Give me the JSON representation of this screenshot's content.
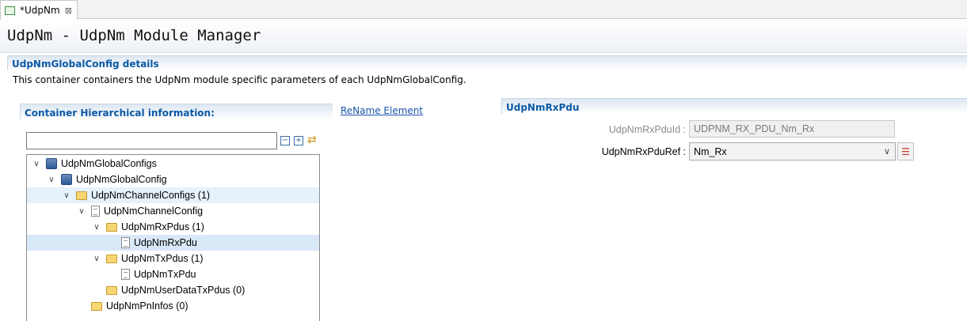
{
  "tab": {
    "label": "*UdpNm",
    "close": "⊠"
  },
  "header": {
    "title": "UdpNm - UdpNm Module Manager"
  },
  "details": {
    "title": "UdpNmGlobalConfig details",
    "description": "This container containers the UdpNm module specific parameters of each UdpNmGlobalConfig."
  },
  "hierarchy": {
    "title": "Container Hierarchical information:",
    "search": {
      "value": "",
      "placeholder": ""
    },
    "tree": [
      {
        "label": "UdpNmGlobalConfigs",
        "level": 0,
        "icon": "database-icon",
        "expanded": true
      },
      {
        "label": "UdpNmGlobalConfig",
        "level": 1,
        "icon": "database-icon",
        "expanded": true
      },
      {
        "label": "UdpNmChannelConfigs (1)",
        "level": 2,
        "icon": "folder-icon",
        "expanded": true,
        "hover": true
      },
      {
        "label": "UdpNmChannelConfig",
        "level": 3,
        "icon": "document-icon",
        "expanded": true
      },
      {
        "label": "UdpNmRxPdus (1)",
        "level": 4,
        "icon": "folder-icon",
        "expanded": true
      },
      {
        "label": "UdpNmRxPdu",
        "level": 5,
        "icon": "document-icon",
        "selected": true
      },
      {
        "label": "UdpNmTxPdus (1)",
        "level": 4,
        "icon": "folder-icon",
        "expanded": true
      },
      {
        "label": "UdpNmTxPdu",
        "level": 5,
        "icon": "document-icon"
      },
      {
        "label": "UdpNmUserDataTxPdus (0)",
        "level": 4,
        "icon": "folder-icon"
      },
      {
        "label": "UdpNmPnInfos (0)",
        "level": 3,
        "icon": "folder-icon"
      }
    ]
  },
  "rename_link": "ReName Element",
  "rxpdu": {
    "title": "UdpNmRxPdu",
    "pdu_id_label": "UdpNmRxPduId :",
    "pdu_id_value": "UDPNM_RX_PDU_Nm_Rx",
    "pdu_ref_label": "UdpNmRxPduRef :",
    "pdu_ref_value": "Nm_Rx"
  },
  "colors": {
    "accent": "#0c5aa6",
    "link": "#1a52a8",
    "selection": "#d9e8f7"
  }
}
